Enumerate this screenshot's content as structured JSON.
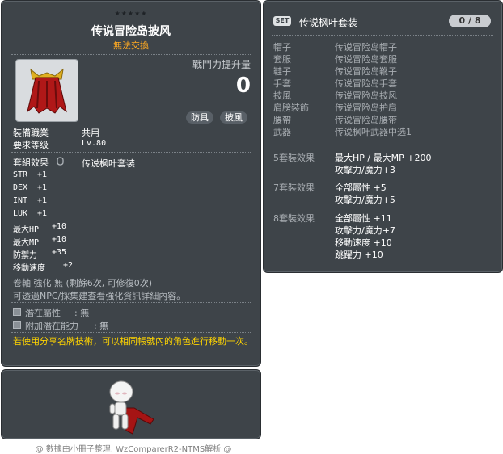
{
  "item_id": "01102322",
  "stars": "★★★★★",
  "item": {
    "name": "传说冒险岛披风",
    "trade_status": "無法交換",
    "power_label": "戰鬥力提升量",
    "power_value": "0",
    "tags": [
      "防具",
      "披風"
    ],
    "job_label": "裝備職業",
    "job_value": "共用",
    "level_label": "要求等级",
    "level_value": "Lv.80",
    "set_label": "套組效果",
    "set_value": "传说枫叶套装",
    "stats": [
      {
        "name": "STR",
        "value": "+1"
      },
      {
        "name": "DEX",
        "value": "+1"
      },
      {
        "name": "INT",
        "value": "+1"
      },
      {
        "name": "LUK",
        "value": "+1"
      },
      {
        "name": "最大HP",
        "value": "+10"
      },
      {
        "name": "最大MP",
        "value": "+10"
      },
      {
        "name": "防禦力",
        "value": "+35"
      },
      {
        "name": "移動速度",
        "value": "+2"
      }
    ],
    "scroll_text": "卷軸 強化 無 (剩餘6次, 可修復0次)",
    "enhance_text": "可透過NPC/採集建查看強化資訊詳細內容。",
    "potential_label": "潛在屬性",
    "potential_value": ": 無",
    "additional_label": "附加潛在能力",
    "additional_value": ": 無",
    "warning": "若使用分享名牌技術，可以相同帳號內的角色進行移動一次。"
  },
  "footer": "@ 數據由小冊子整理, WzComparerR2-NTMS解析 @",
  "set": {
    "badge": "SET",
    "title": "传说枫叶套装",
    "count": "0 / 8",
    "parts": [
      {
        "slot": "帽子",
        "name": "传说冒险岛帽子"
      },
      {
        "slot": "套服",
        "name": "传说冒险岛套服"
      },
      {
        "slot": "鞋子",
        "name": "传说冒险岛靴子"
      },
      {
        "slot": "手套",
        "name": "传说冒险岛手套"
      },
      {
        "slot": "披風",
        "name": "传说冒险岛披风"
      },
      {
        "slot": "肩膀裝飾",
        "name": "传说冒险岛护肩"
      },
      {
        "slot": "腰帶",
        "name": "传说冒险岛腰带"
      },
      {
        "slot": "武器",
        "name": "传说枫叶武器中选1"
      }
    ],
    "bonuses": [
      {
        "label": "5套裝效果",
        "lines": [
          "最大HP / 最大MP  +200",
          "攻擊力/魔力+3"
        ]
      },
      {
        "label": "7套裝效果",
        "lines": [
          "全部屬性  +5",
          "攻擊力/魔力+5"
        ]
      },
      {
        "label": "8套裝效果",
        "lines": [
          "全部屬性 +11",
          "攻擊力/魔力+7",
          "移動速度  +10",
          "跳躍力  +10"
        ]
      }
    ]
  },
  "colors": {
    "panel": "#3e4449",
    "gold": "#ffaa22",
    "warning": "#ffd400",
    "cape": "#b01818"
  }
}
